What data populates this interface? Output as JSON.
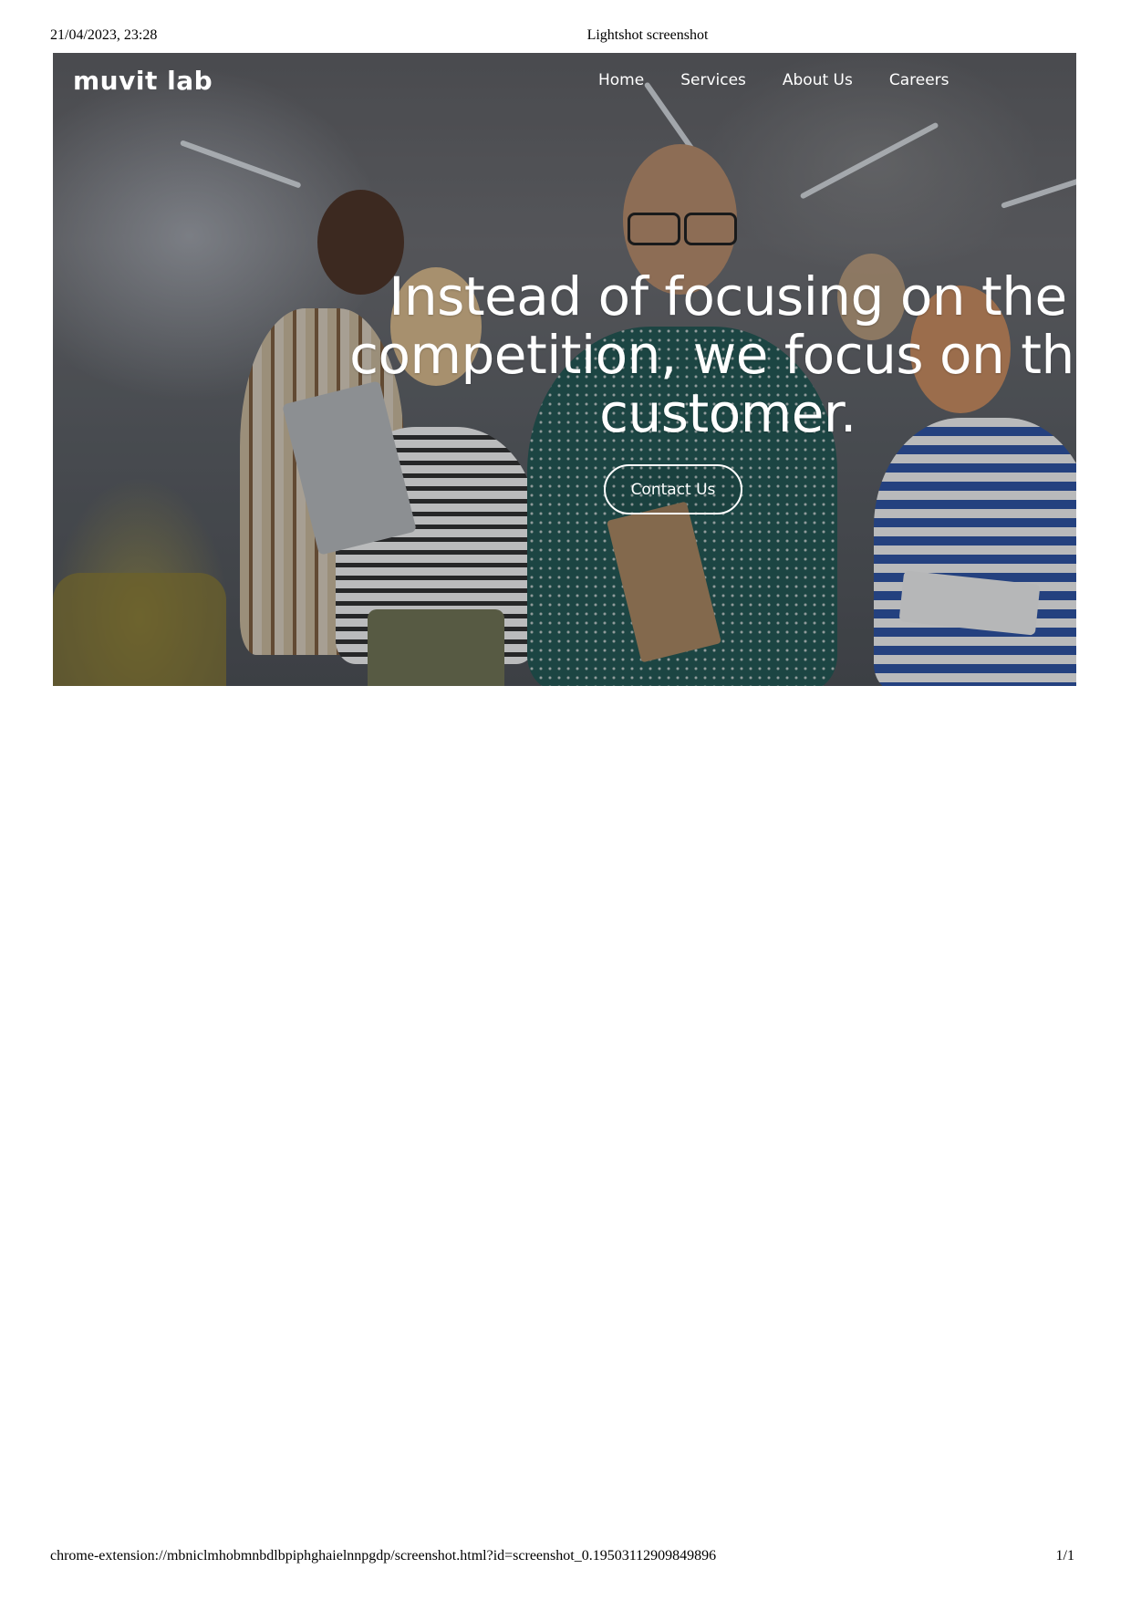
{
  "print": {
    "datetime": "21/04/2023, 23:28",
    "doc_title": "Lightshot screenshot",
    "url": "chrome-extension://mbniclmhobmnbdlbpiphghaielnnpgdp/screenshot.html?id=screenshot_0.19503112909849896",
    "page": "1/1"
  },
  "site": {
    "logo_text": "muvit lab",
    "nav": [
      {
        "label": "Home"
      },
      {
        "label": "Services"
      },
      {
        "label": "About Us"
      },
      {
        "label": "Careers"
      }
    ],
    "hero": {
      "headline": "Instead of focusing on the competition, we focus on the customer.",
      "cta_label": "Contact Us"
    }
  }
}
